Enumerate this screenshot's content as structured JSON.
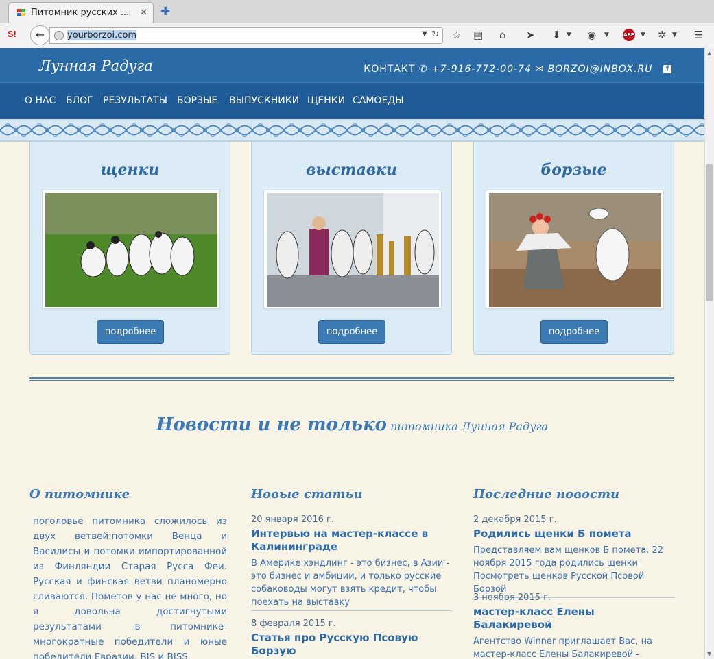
{
  "browser": {
    "tab_title": "Питомник русских ...",
    "tab_close": "✕",
    "new_tab": "✚",
    "url": "yourborzoi.com",
    "sicon": "S!",
    "back": "←",
    "url_dropdown": "▼",
    "reload": "↻",
    "toolbar_icons": [
      "star-icon",
      "reading-list-icon",
      "home-icon",
      "send-icon",
      "download-icon",
      "privacy-icon",
      "abp-icon",
      "extension-icon",
      "menu-icon"
    ]
  },
  "site": {
    "logo": "Лунная Радуга",
    "contact_label": "КОНТАКТ",
    "phone": "+7-916-772-00-74",
    "email": "BORZOI@INBOX.RU",
    "facebook": "f",
    "menu": [
      "О НАС",
      "БЛОГ",
      "РЕЗУЛЬТАТЫ",
      "БОРЗЫЕ",
      "ВЫПУСКНИКИ",
      "ЩЕНКИ",
      "САМОЕДЫ"
    ]
  },
  "cards": [
    {
      "title": "щенки",
      "button": "подробнее"
    },
    {
      "title": "выставки",
      "button": "подробнее"
    },
    {
      "title": "борзые",
      "button": "подробнее"
    }
  ],
  "news_heading": {
    "big": "Новости и не только",
    "small": "питомника Лунная Радуга"
  },
  "about": {
    "title": "О питомнике",
    "text": "поголовье питомника сложилось из двух ветвей:потомки Венца и Василисы и потомки импортированной из Финляндии Старая Русса Феи. Русская и финская ветви планомерно сливаются. Пометов у нас не много, но я довольна достигнутыми результатами -в питомнике-многократные победители и юные победители Евразии, BIS и BISS"
  },
  "articles": {
    "title": "Новые статьи",
    "items": [
      {
        "date": "20 января 2016 г.",
        "head": "Интервью на мастер-классе в Калининграде",
        "text": "В Америке хэндлинг - это бизнес, в Азии - это бизнес и амбиции, и только русские собаководы могут взять кредит, чтобы поехать на выставку"
      },
      {
        "date": "8 февраля 2015 г.",
        "head": "Статья про Русскую Псовую Борзую",
        "text": ""
      }
    ]
  },
  "latest": {
    "title": "Последние новости",
    "items": [
      {
        "date": "2 декабря 2015 г.",
        "head": "Родились щенки Б помета",
        "text": "Представляем вам щенков Б помета. 22 ноября 2015 года родились щенки Посмотреть щенков Русской Псовой Борзой"
      },
      {
        "date": "3 ноября 2015 г.",
        "head": "мастер-класс Елены Балакиревой",
        "text": "Агентство Winner приглашает Вас, на мастер-класс Елены Балакиревой - \"ЛЕГКАЯ ДОРОГА НАВЕРХ\""
      }
    ]
  },
  "colors": {
    "header": "#2a6aa6",
    "menu": "#1f5b96",
    "card": "#dcecf6",
    "accent": "#3b78b5",
    "page": "#f7f4e6"
  }
}
